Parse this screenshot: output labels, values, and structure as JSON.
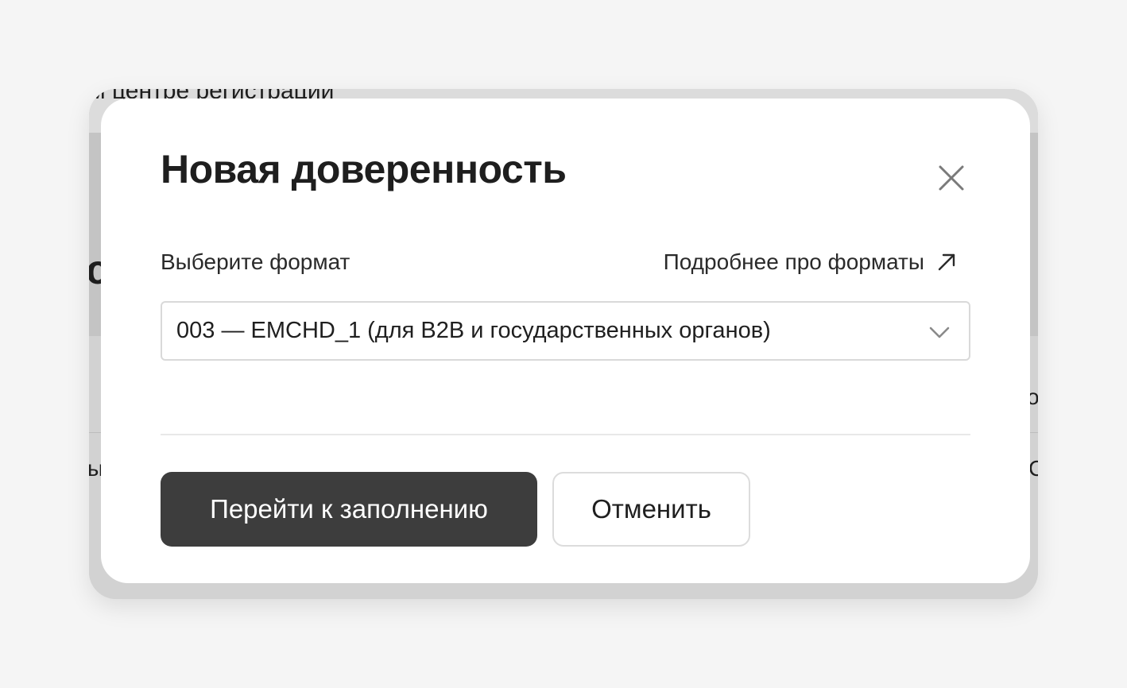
{
  "background": {
    "partial_text_top": "м центре регистрации",
    "fragment_left_heading": "с",
    "fragment_left_row": "ы",
    "fragment_right_header": "о",
    "fragment_right_row": "С"
  },
  "dialog": {
    "title": "Новая доверенность",
    "close_icon": "close-icon",
    "format_label": "Выберите формат",
    "formats_link": {
      "label": "Подробнее про форматы",
      "icon": "arrow-up-right-icon"
    },
    "format_select": {
      "value": "003 — EMCHD_1 (для B2B и государственных органов)",
      "icon": "chevron-down-icon"
    },
    "buttons": {
      "primary_label": "Перейти к заполнению",
      "cancel_label": "Отменить"
    }
  },
  "colors": {
    "primary_button_bg": "#3d3d3d",
    "overlay": "#d2d2d2",
    "page_bg": "#f5f5f5",
    "text": "#1e1e1e"
  }
}
